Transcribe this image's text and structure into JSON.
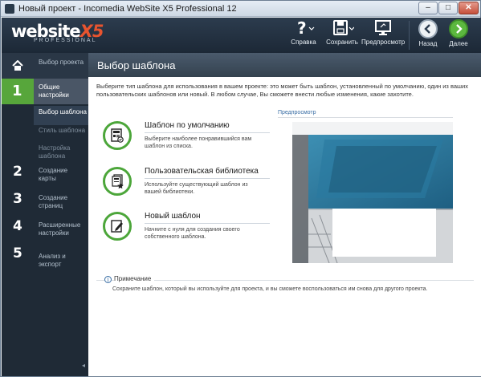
{
  "window": {
    "title": "Новый проект - Incomedia WebSite X5 Professional 12"
  },
  "logo": {
    "name": "website",
    "version": "X5",
    "edition": "PROFESSIONAL"
  },
  "toolbar": {
    "help_label": "Справка",
    "save_label": "Сохранить",
    "preview_label": "Предпросмотр",
    "back_label": "Назад",
    "next_label": "Далее"
  },
  "sidebar": {
    "home_label": "Выбор проекта",
    "steps": [
      {
        "num": "1",
        "label": "Общие настройки"
      },
      {
        "num": "2",
        "label": "Создание карты"
      },
      {
        "num": "3",
        "label": "Создание страниц"
      },
      {
        "num": "4",
        "label": "Расширенные настройки"
      },
      {
        "num": "5",
        "label": "Анализ и экспорт"
      }
    ],
    "sub_items": [
      {
        "label": "Выбор шаблона"
      },
      {
        "label": "Стиль шаблона"
      },
      {
        "label": "Настройка шаблона"
      }
    ],
    "collapse_glyph": "◂"
  },
  "main": {
    "title": "Выбор шаблона",
    "intro": "Выберите тип шаблона для использования в вашем проекте: это может быть шаблон, установленный по умолчанию, один из ваших пользовательских шаблонов или новый. В любом случае, Вы сможете внести любые изменения, какие захотите.",
    "options": [
      {
        "title": "Шаблон по умолчанию",
        "desc": "Выберите наиболее понравившийся вам шаблон из списка."
      },
      {
        "title": "Пользовательская библиотека",
        "desc": "Используйте существующий шаблон из вашей библиотеки."
      },
      {
        "title": "Новый шаблон",
        "desc": "Начните с нуля для создания своего собственного шаблона."
      }
    ],
    "preview_label": "Предпросмотр",
    "note": {
      "title": "Примечание",
      "text": "Сохраните шаблон, который вы используйте для проекта, и вы сможете воспользоваться им снова для другого проекта."
    }
  },
  "colors": {
    "accent_green": "#4ca63a",
    "sidebar_bg": "#1f2a36",
    "header_bg": "#34424f",
    "link_blue": "#3a6ea5"
  }
}
